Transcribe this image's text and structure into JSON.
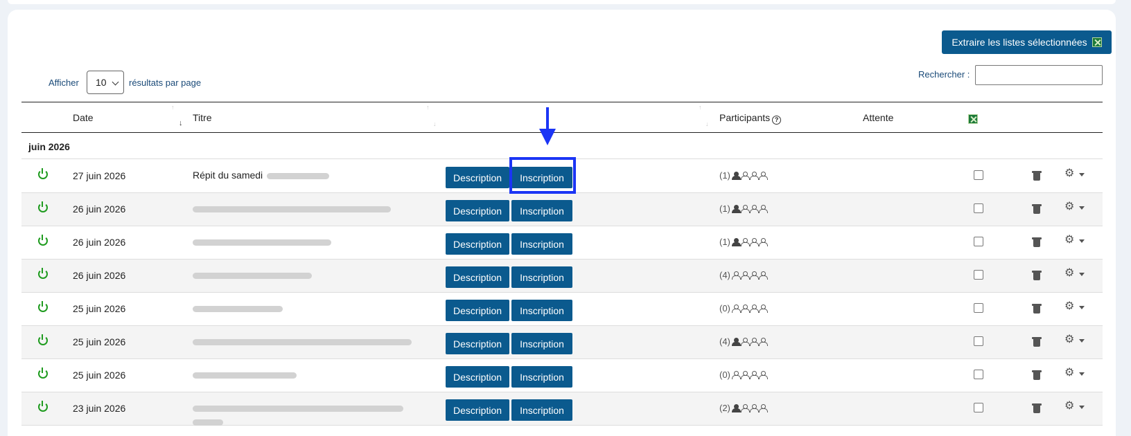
{
  "toolbar": {
    "export_label": "Extraire les listes sélectionnées"
  },
  "length": {
    "show_label": "Afficher",
    "value": "10",
    "suffix_label": "résultats par page"
  },
  "search": {
    "label": "Rechercher :",
    "value": ""
  },
  "columns": {
    "date": "Date",
    "title": "Titre",
    "participants": "Participants",
    "waiting": "Attente"
  },
  "group": {
    "label": "juin 2026"
  },
  "buttons": {
    "description": "Description",
    "inscription": "Inscription"
  },
  "rows": [
    {
      "date": "27 juin 2026",
      "title": "Répit du samedi",
      "participants": "(1)",
      "full": 1
    },
    {
      "date": "26 juin 2026",
      "title": "",
      "participants": "(1)",
      "full": 1
    },
    {
      "date": "26 juin 2026",
      "title": "",
      "participants": "(1)",
      "full": 1
    },
    {
      "date": "26 juin 2026",
      "title": "",
      "participants": "(4)",
      "full": 0
    },
    {
      "date": "25 juin 2026",
      "title": "",
      "participants": "(0)",
      "full": 0
    },
    {
      "date": "25 juin 2026",
      "title": "",
      "participants": "(4)",
      "full": 1
    },
    {
      "date": "25 juin 2026",
      "title": "",
      "participants": "(0)",
      "full": 0
    },
    {
      "date": "23 juin 2026",
      "title": "",
      "participants": "(2)",
      "full": 1
    }
  ],
  "colors": {
    "primary": "#0b5a8e",
    "annotation": "#1b35f5",
    "power": "#1e9b1e"
  }
}
